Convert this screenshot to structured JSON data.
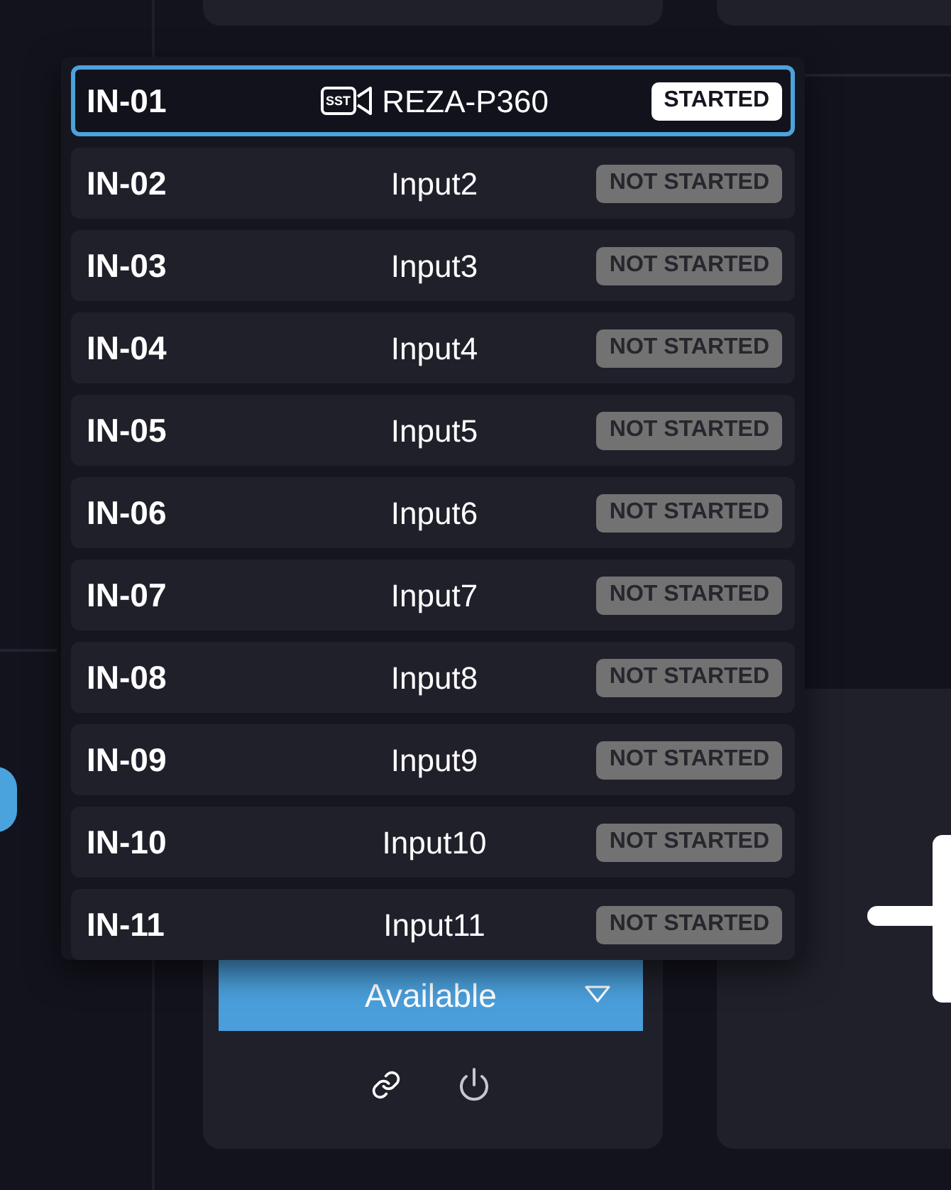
{
  "inputs": [
    {
      "id": "IN-01",
      "name": "REZA-P360",
      "source_tag": "SST",
      "status": "STARTED",
      "started": true,
      "selected": true
    },
    {
      "id": "IN-02",
      "name": "Input2",
      "status": "NOT STARTED",
      "started": false,
      "selected": false
    },
    {
      "id": "IN-03",
      "name": "Input3",
      "status": "NOT STARTED",
      "started": false,
      "selected": false
    },
    {
      "id": "IN-04",
      "name": "Input4",
      "status": "NOT STARTED",
      "started": false,
      "selected": false
    },
    {
      "id": "IN-05",
      "name": "Input5",
      "status": "NOT STARTED",
      "started": false,
      "selected": false
    },
    {
      "id": "IN-06",
      "name": "Input6",
      "status": "NOT STARTED",
      "started": false,
      "selected": false
    },
    {
      "id": "IN-07",
      "name": "Input7",
      "status": "NOT STARTED",
      "started": false,
      "selected": false
    },
    {
      "id": "IN-08",
      "name": "Input8",
      "status": "NOT STARTED",
      "started": false,
      "selected": false
    },
    {
      "id": "IN-09",
      "name": "Input9",
      "status": "NOT STARTED",
      "started": false,
      "selected": false
    },
    {
      "id": "IN-10",
      "name": "Input10",
      "status": "NOT STARTED",
      "started": false,
      "selected": false
    },
    {
      "id": "IN-11",
      "name": "Input11",
      "status": "NOT STARTED",
      "started": false,
      "selected": false
    }
  ],
  "availability": {
    "value": "Available"
  }
}
